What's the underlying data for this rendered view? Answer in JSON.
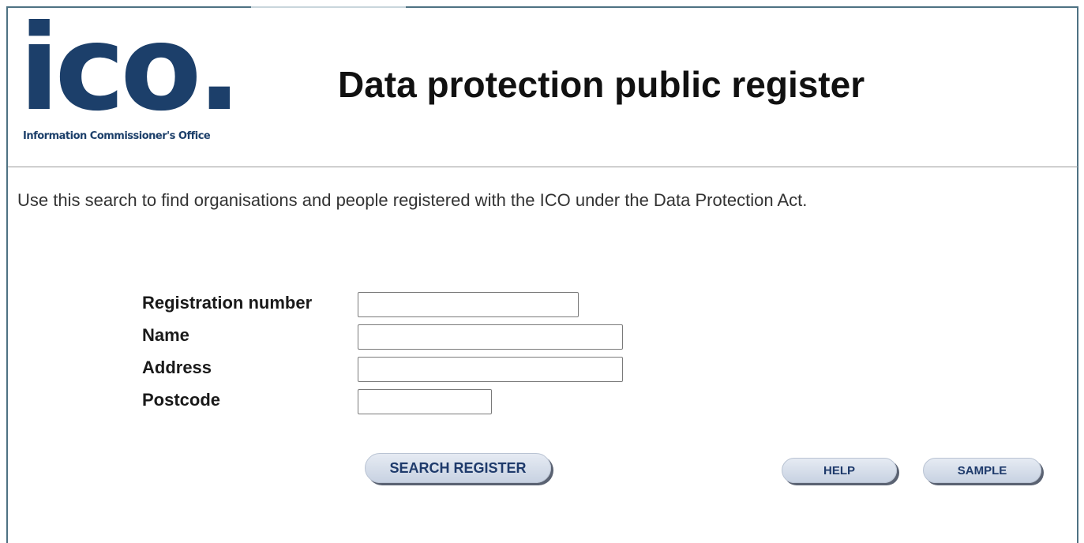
{
  "header": {
    "logo_text": "ico.",
    "logo_subtitle": "Information Commissioner's Office",
    "title": "Data protection public register"
  },
  "intro": "Use this search to find organisations and people registered with the ICO under the Data Protection Act.",
  "form": {
    "fields": [
      {
        "label": "Registration number",
        "value": ""
      },
      {
        "label": "Name",
        "value": ""
      },
      {
        "label": "Address",
        "value": ""
      },
      {
        "label": "Postcode",
        "value": ""
      }
    ]
  },
  "buttons": {
    "search": "SEARCH REGISTER",
    "help": "HELP",
    "sample": "SAMPLE"
  },
  "colors": {
    "brand": "#1c3f6a",
    "frame": "#4e7283",
    "button_text": "#1e3a6b"
  }
}
